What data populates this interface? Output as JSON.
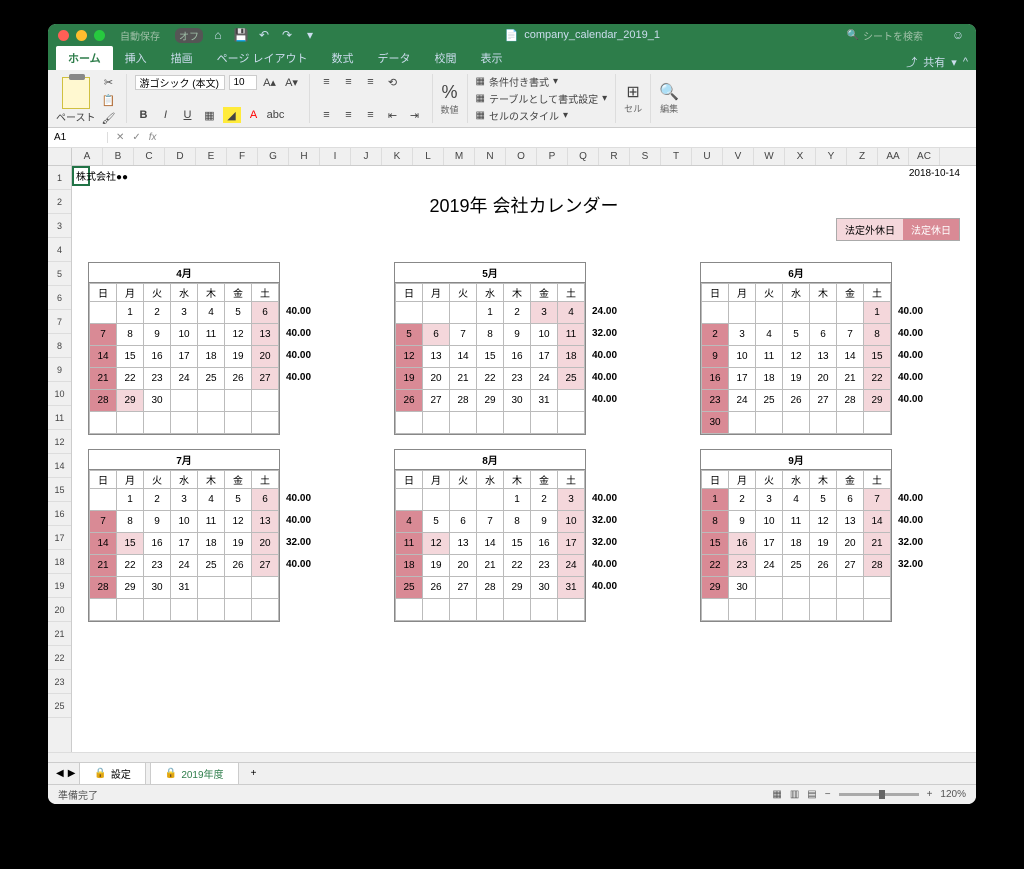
{
  "titlebar": {
    "autosave": "自動保存",
    "autosave_state": "オフ",
    "filename": "company_calendar_2019_1",
    "search_placeholder": "シートを検索"
  },
  "tabs": [
    "ホーム",
    "挿入",
    "描画",
    "ページ レイアウト",
    "数式",
    "データ",
    "校閲",
    "表示"
  ],
  "active_tab": 0,
  "share": "共有",
  "ribbon": {
    "paste": "ペースト",
    "font_name": "游ゴシック (本文)",
    "font_size": "10",
    "number_group": "数値",
    "cond_format": "条件付き書式",
    "format_table": "テーブルとして書式設定",
    "cell_styles": "セルのスタイル",
    "cell_group": "セル",
    "edit_group": "編集"
  },
  "namebox": "A1",
  "columns": [
    "A",
    "B",
    "C",
    "D",
    "E",
    "F",
    "G",
    "H",
    "I",
    "J",
    "K",
    "L",
    "M",
    "N",
    "O",
    "P",
    "Q",
    "R",
    "S",
    "T",
    "U",
    "V",
    "W",
    "X",
    "Y",
    "Z",
    "AA",
    "AC"
  ],
  "rows": [
    "1",
    "2",
    "3",
    "4",
    "5",
    "6",
    "7",
    "8",
    "9",
    "10",
    "11",
    "12",
    "14",
    "15",
    "16",
    "17",
    "18",
    "19",
    "20",
    "21",
    "22",
    "23",
    "25"
  ],
  "doc": {
    "company": "株式会社●●",
    "date_stamp": "2018-10-14",
    "title": "2019年 会社カレンダー",
    "legend1": "法定外休日",
    "legend2": "法定休日",
    "dow": [
      "日",
      "月",
      "火",
      "水",
      "木",
      "金",
      "土"
    ]
  },
  "months": [
    {
      "name": "4月",
      "hours": [
        "40.00",
        "40.00",
        "40.00",
        "40.00"
      ],
      "weeks": [
        [
          "",
          "1",
          "2",
          "3",
          "4",
          "5",
          {
            "v": "6",
            "c": "red2"
          }
        ],
        [
          {
            "v": "7",
            "c": "red1"
          },
          "8",
          "9",
          "10",
          "11",
          "12",
          {
            "v": "13",
            "c": "red2"
          }
        ],
        [
          {
            "v": "14",
            "c": "red1"
          },
          "15",
          "16",
          "17",
          "18",
          "19",
          {
            "v": "20",
            "c": "red2"
          }
        ],
        [
          {
            "v": "21",
            "c": "red1"
          },
          "22",
          "23",
          "24",
          "25",
          "26",
          {
            "v": "27",
            "c": "red2"
          }
        ],
        [
          {
            "v": "28",
            "c": "red1"
          },
          {
            "v": "29",
            "c": "red2"
          },
          "30",
          "",
          "",
          "",
          ""
        ],
        [
          "",
          "",
          "",
          "",
          "",
          "",
          ""
        ]
      ]
    },
    {
      "name": "5月",
      "hours": [
        "24.00",
        "32.00",
        "40.00",
        "40.00",
        "40.00"
      ],
      "weeks": [
        [
          "",
          "",
          "",
          "1",
          "2",
          {
            "v": "3",
            "c": "red2"
          },
          {
            "v": "4",
            "c": "red2"
          }
        ],
        [
          {
            "v": "5",
            "c": "red1"
          },
          {
            "v": "6",
            "c": "red2"
          },
          "7",
          "8",
          "9",
          "10",
          {
            "v": "11",
            "c": "red2"
          }
        ],
        [
          {
            "v": "12",
            "c": "red1"
          },
          "13",
          "14",
          "15",
          "16",
          "17",
          {
            "v": "18",
            "c": "red2"
          }
        ],
        [
          {
            "v": "19",
            "c": "red1"
          },
          "20",
          "21",
          "22",
          "23",
          "24",
          {
            "v": "25",
            "c": "red2"
          }
        ],
        [
          {
            "v": "26",
            "c": "red1"
          },
          "27",
          "28",
          "29",
          "30",
          "31",
          ""
        ],
        [
          "",
          "",
          "",
          "",
          "",
          "",
          ""
        ]
      ]
    },
    {
      "name": "6月",
      "hours": [
        "40.00",
        "40.00",
        "40.00",
        "40.00",
        "40.00"
      ],
      "weeks": [
        [
          "",
          "",
          "",
          "",
          "",
          "",
          {
            "v": "1",
            "c": "red2"
          }
        ],
        [
          {
            "v": "2",
            "c": "red1"
          },
          "3",
          "4",
          "5",
          "6",
          "7",
          {
            "v": "8",
            "c": "red2"
          }
        ],
        [
          {
            "v": "9",
            "c": "red1"
          },
          "10",
          "11",
          "12",
          "13",
          "14",
          {
            "v": "15",
            "c": "red2"
          }
        ],
        [
          {
            "v": "16",
            "c": "red1"
          },
          "17",
          "18",
          "19",
          "20",
          "21",
          {
            "v": "22",
            "c": "red2"
          }
        ],
        [
          {
            "v": "23",
            "c": "red1"
          },
          "24",
          "25",
          "26",
          "27",
          "28",
          {
            "v": "29",
            "c": "red2"
          }
        ],
        [
          {
            "v": "30",
            "c": "red1"
          },
          "",
          "",
          "",
          "",
          "",
          ""
        ]
      ]
    },
    {
      "name": "7月",
      "hours": [
        "40.00",
        "40.00",
        "32.00",
        "40.00"
      ],
      "weeks": [
        [
          "",
          "1",
          "2",
          "3",
          "4",
          "5",
          {
            "v": "6",
            "c": "red2"
          }
        ],
        [
          {
            "v": "7",
            "c": "red1"
          },
          "8",
          "9",
          "10",
          "11",
          "12",
          {
            "v": "13",
            "c": "red2"
          }
        ],
        [
          {
            "v": "14",
            "c": "red1"
          },
          {
            "v": "15",
            "c": "red2"
          },
          "16",
          "17",
          "18",
          "19",
          {
            "v": "20",
            "c": "red2"
          }
        ],
        [
          {
            "v": "21",
            "c": "red1"
          },
          "22",
          "23",
          "24",
          "25",
          "26",
          {
            "v": "27",
            "c": "red2"
          }
        ],
        [
          {
            "v": "28",
            "c": "red1"
          },
          "29",
          "30",
          "31",
          "",
          "",
          ""
        ],
        [
          "",
          "",
          "",
          "",
          "",
          "",
          ""
        ]
      ]
    },
    {
      "name": "8月",
      "hours": [
        "40.00",
        "32.00",
        "32.00",
        "40.00",
        "40.00"
      ],
      "weeks": [
        [
          "",
          "",
          "",
          "",
          "1",
          "2",
          {
            "v": "3",
            "c": "red2"
          }
        ],
        [
          {
            "v": "4",
            "c": "red1"
          },
          "5",
          "6",
          "7",
          "8",
          "9",
          {
            "v": "10",
            "c": "red2"
          }
        ],
        [
          {
            "v": "11",
            "c": "red1"
          },
          {
            "v": "12",
            "c": "red2"
          },
          "13",
          "14",
          "15",
          "16",
          {
            "v": "17",
            "c": "red2"
          }
        ],
        [
          {
            "v": "18",
            "c": "red1"
          },
          "19",
          "20",
          "21",
          "22",
          "23",
          {
            "v": "24",
            "c": "red2"
          }
        ],
        [
          {
            "v": "25",
            "c": "red1"
          },
          "26",
          "27",
          "28",
          "29",
          "30",
          {
            "v": "31",
            "c": "red2"
          }
        ],
        [
          "",
          "",
          "",
          "",
          "",
          "",
          ""
        ]
      ]
    },
    {
      "name": "9月",
      "hours": [
        "40.00",
        "40.00",
        "32.00",
        "32.00"
      ],
      "weeks": [
        [
          {
            "v": "1",
            "c": "red1"
          },
          "2",
          "3",
          "4",
          "5",
          "6",
          {
            "v": "7",
            "c": "red2"
          }
        ],
        [
          {
            "v": "8",
            "c": "red1"
          },
          "9",
          "10",
          "11",
          "12",
          "13",
          {
            "v": "14",
            "c": "red2"
          }
        ],
        [
          {
            "v": "15",
            "c": "red1"
          },
          {
            "v": "16",
            "c": "red2"
          },
          "17",
          "18",
          "19",
          "20",
          {
            "v": "21",
            "c": "red2"
          }
        ],
        [
          {
            "v": "22",
            "c": "red1"
          },
          {
            "v": "23",
            "c": "red2"
          },
          "24",
          "25",
          "26",
          "27",
          {
            "v": "28",
            "c": "red2"
          }
        ],
        [
          {
            "v": "29",
            "c": "red1"
          },
          "30",
          "",
          "",
          "",
          "",
          ""
        ],
        [
          "",
          "",
          "",
          "",
          "",
          "",
          ""
        ]
      ]
    }
  ],
  "sheets": {
    "tab1": "設定",
    "tab2": "2019年度"
  },
  "status": {
    "ready": "準備完了",
    "zoom": "120%"
  }
}
